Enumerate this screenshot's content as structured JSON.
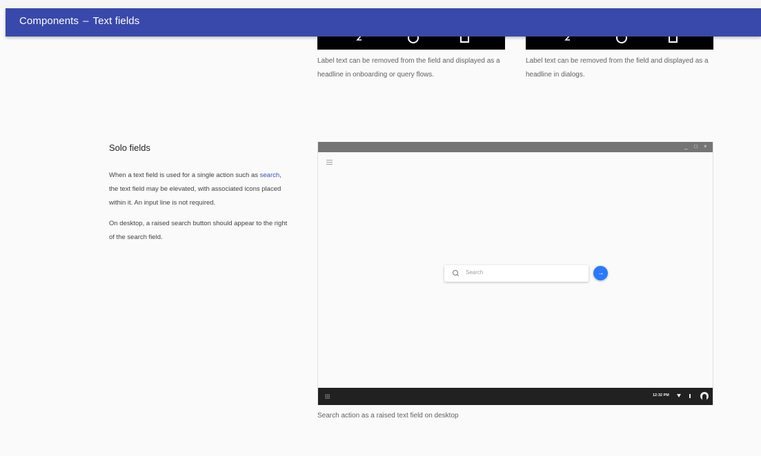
{
  "appbar": {
    "section": "Components",
    "separator": "–",
    "page": "Text fields"
  },
  "top_captions": [
    {
      "line1": "Label text can be removed from the field and displayed as a",
      "line2": "headline in onboarding or query flows."
    },
    {
      "line1": "Label text can be removed from the field and displayed as a",
      "line2": "headline in dialogs."
    }
  ],
  "solo_fields": {
    "title": "Solo fields",
    "p1_line1_prefix": "When a text field is used for a single action such as ",
    "p1_link": "search",
    "p1_line1_suffix": ",",
    "p1_line2": "the text field may be elevated, with associated icons placed",
    "p1_line3": "within it. An input line is not required.",
    "p2_line1": "On desktop, a raised search button should appear to the right",
    "p2_line2": "of the search field."
  },
  "desktop_mock": {
    "window_controls": [
      "_",
      "□",
      "×"
    ],
    "search_placeholder": "Search",
    "go_icon": "→",
    "clock": "12:32 PM",
    "caption": "Search action as a raised text field on desktop"
  },
  "colors": {
    "appbar": "#3949ab",
    "link": "#3f51b5",
    "search_button": "#2979ff"
  }
}
